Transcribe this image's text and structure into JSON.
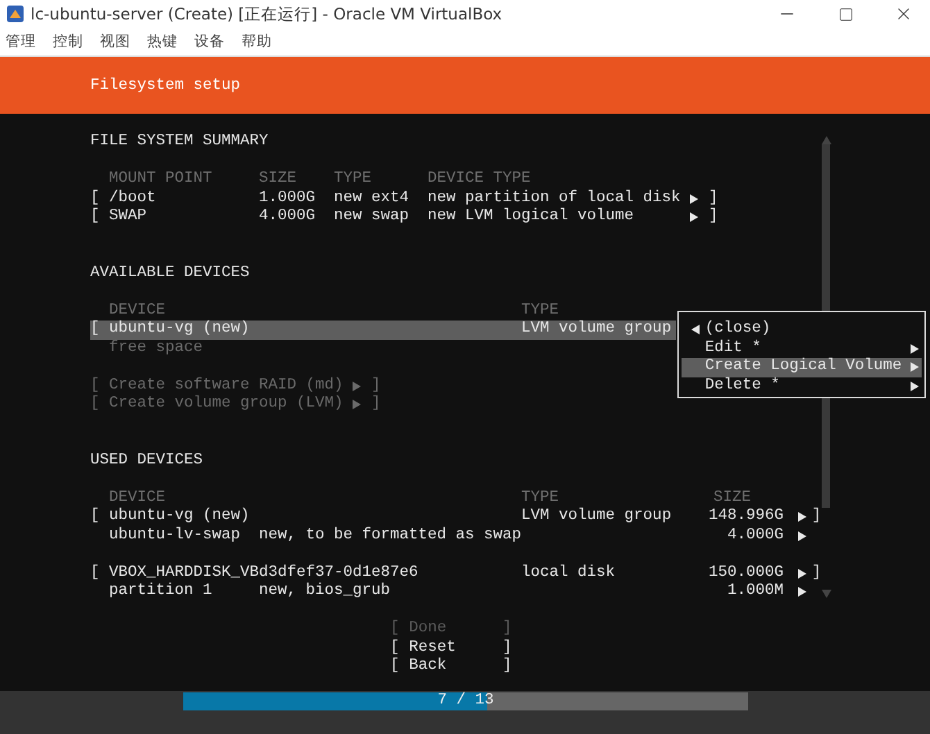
{
  "window": {
    "title": "lc-ubuntu-server (Create) [正在运行] - Oracle VM VirtualBox"
  },
  "menu_bar": [
    "管理",
    "控制",
    "视图",
    "热键",
    "设备",
    "帮助"
  ],
  "header": {
    "title": "Filesystem setup"
  },
  "file_system_summary": {
    "title": "FILE SYSTEM SUMMARY",
    "columns": [
      "MOUNT POINT",
      "SIZE",
      "TYPE",
      "DEVICE TYPE"
    ],
    "rows": [
      {
        "open_bracket": "[",
        "mount_point": "/boot",
        "size": "1.000G",
        "type": "new ext4",
        "device_type": "new partition of local disk",
        "close_bracket": "]"
      },
      {
        "open_bracket": "[",
        "mount_point": "SWAP",
        "size": "4.000G",
        "type": "new swap",
        "device_type": "new LVM logical volume",
        "close_bracket": "]"
      }
    ]
  },
  "available_devices": {
    "title": "AVAILABLE DEVICES",
    "columns": [
      "DEVICE",
      "TYPE"
    ],
    "rows": [
      {
        "kind": "device",
        "open_bracket": "[",
        "device": "ubuntu-vg (new)",
        "type": "LVM volume group",
        "selected": true
      },
      {
        "kind": "free",
        "device": "free space",
        "selected": false
      }
    ],
    "actions": [
      {
        "open_bracket": "[",
        "label": "Create software RAID (md)",
        "close_bracket": "]",
        "disabled": true
      },
      {
        "open_bracket": "[",
        "label": "Create volume group (LVM)",
        "close_bracket": "]",
        "disabled": true
      }
    ]
  },
  "context_menu": {
    "items": [
      {
        "kind": "back",
        "label": "(close)",
        "selected": false
      },
      {
        "kind": "submenu",
        "label": "Edit *",
        "selected": false
      },
      {
        "kind": "submenu",
        "label": "Create Logical Volume",
        "selected": true
      },
      {
        "kind": "submenu",
        "label": "Delete *",
        "selected": false
      }
    ]
  },
  "used_devices": {
    "title": "USED DEVICES",
    "columns": [
      "DEVICE",
      "TYPE",
      "SIZE"
    ],
    "groups": [
      {
        "open_bracket": "[",
        "device": "ubuntu-vg (new)",
        "type": "LVM volume group",
        "size": "148.996G",
        "close_bracket": "]",
        "children": [
          {
            "device": "ubuntu-lv-swap",
            "note": "new, to be formatted as swap",
            "size": "4.000G"
          }
        ]
      },
      {
        "open_bracket": "[",
        "device": "VBOX_HARDDISK_VBd3dfef37-0d1e87e6",
        "type": "local disk",
        "size": "150.000G",
        "close_bracket": "]",
        "children": [
          {
            "device": "partition 1",
            "note": "new, bios_grub",
            "size": "1.000M"
          }
        ]
      }
    ]
  },
  "buttons": [
    {
      "open_bracket": "[",
      "label": "Done",
      "close_bracket": "]",
      "disabled": true
    },
    {
      "open_bracket": "[",
      "label": "Reset",
      "close_bracket": "]",
      "disabled": false
    },
    {
      "open_bracket": "[",
      "label": "Back",
      "close_bracket": "]",
      "disabled": false
    }
  ],
  "progress": {
    "label": "7 / 13",
    "level": 0.538
  }
}
